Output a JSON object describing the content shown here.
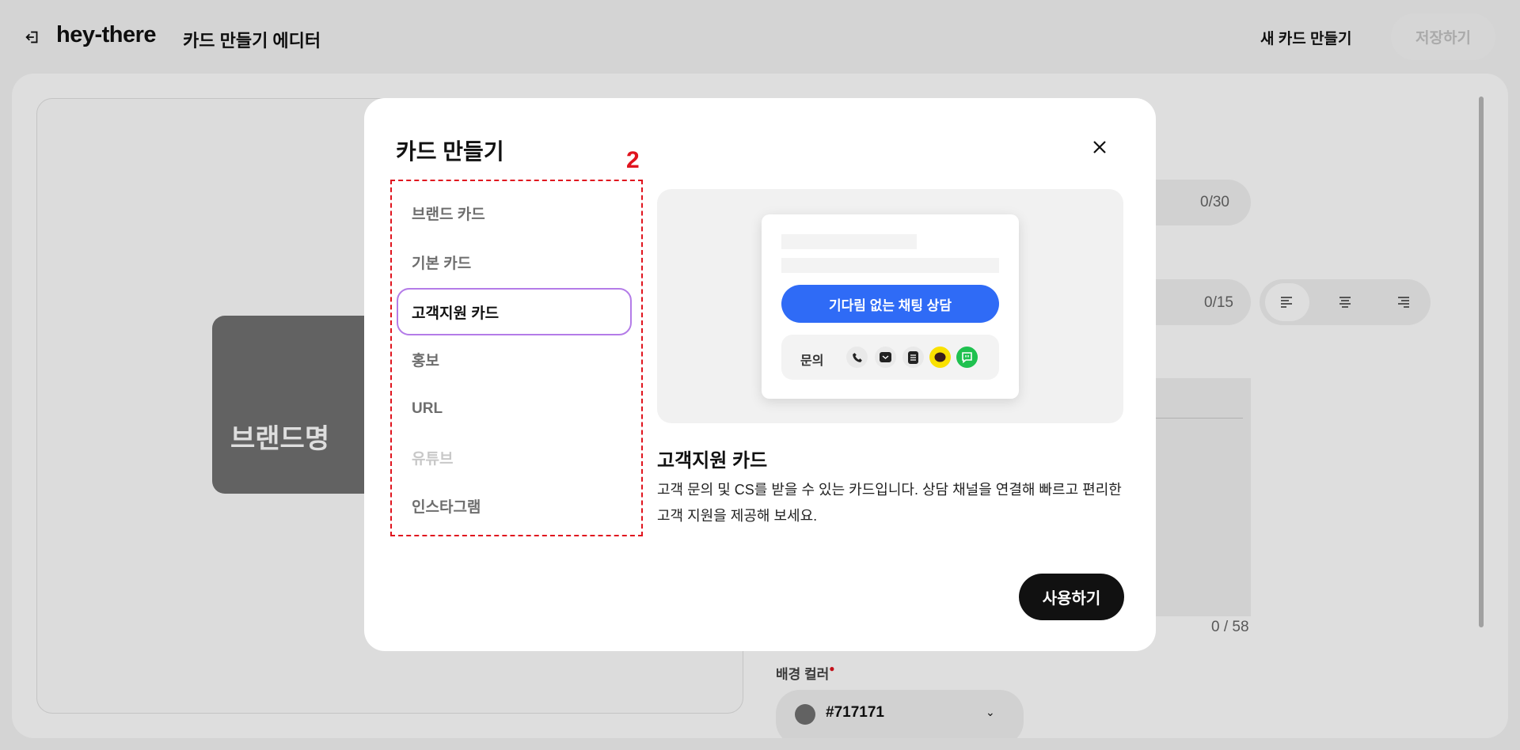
{
  "header": {
    "brand": "hey-there",
    "subtitle": "카드 만들기 에디터",
    "new_card": "새 카드 만들기",
    "save": "저장하기"
  },
  "editor": {
    "brand_card_text": "브랜드명",
    "brand_card_color": "#717171",
    "title_counter": "0/30",
    "subtitle_counter": "0/15",
    "desc_counter": "0 / 58",
    "bg_color_label": "배경 컬러",
    "bg_color_value": "#717171",
    "align_options": [
      "left",
      "center",
      "right"
    ]
  },
  "modal": {
    "title": "카드 만들기",
    "annotation": "2",
    "items": [
      {
        "label": "브랜드 카드",
        "state": "normal"
      },
      {
        "label": "기본 카드",
        "state": "normal"
      },
      {
        "label": "고객지원 카드",
        "state": "selected"
      },
      {
        "label": "홍보",
        "state": "normal"
      },
      {
        "label": "URL",
        "state": "normal"
      },
      {
        "label": "유튜브",
        "state": "disabled"
      },
      {
        "label": "인스타그램",
        "state": "normal"
      }
    ],
    "preview": {
      "cta": "기다림 없는 채팅 상담",
      "inquiry_label": "문의",
      "channels": [
        "phone-icon",
        "mail-icon",
        "document-icon",
        "kakaotalk-icon",
        "naver-talk-icon"
      ]
    },
    "selected_title": "고객지원 카드",
    "selected_desc": "고객 문의 및 CS를 받을 수 있는 카드입니다. 상담 채널을 연결해 빠르고 편리한 고객 지원을 제공해 보세요.",
    "use_button": "사용하기",
    "colors": {
      "accent": "#2f6bf6",
      "selected_border": "#b47ce8",
      "annotation": "#e0141e"
    }
  }
}
